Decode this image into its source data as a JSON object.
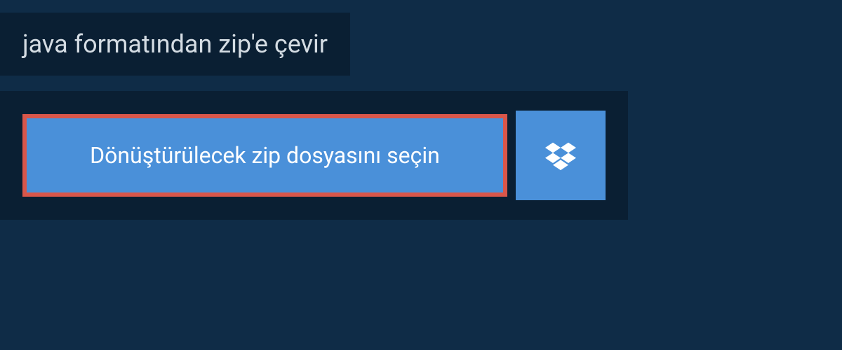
{
  "header": {
    "title": "java formatından zip'e çevir"
  },
  "main": {
    "select_file_label": "Dönüştürülecek zip dosyasını seçin"
  },
  "colors": {
    "background": "#0f2c47",
    "panel": "#0a1f33",
    "button": "#4a90d9",
    "button_border": "#d9564a",
    "text_light": "#d4dce3",
    "text_white": "#ffffff"
  }
}
